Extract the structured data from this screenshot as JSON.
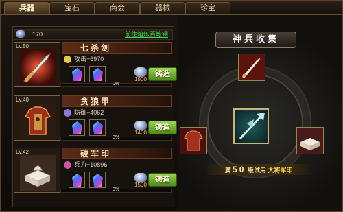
{
  "tabs": [
    {
      "label": "兵器",
      "active": true
    },
    {
      "label": "宝石",
      "active": false
    },
    {
      "label": "商会",
      "active": false
    },
    {
      "label": "器械",
      "active": false
    },
    {
      "label": "珍宝",
      "active": false
    }
  ],
  "resource": {
    "count": "170",
    "link": "前往熔炼百炼钢",
    "icon": "refined-steel-icon"
  },
  "items": [
    {
      "level": "Lv.50",
      "name": "七杀剑",
      "stat": "攻击+6970",
      "cost": "1900",
      "forge_label": "铸造",
      "progress_pct": 0,
      "progress_label": "0%",
      "stat_color": "#e8c74a"
    },
    {
      "level": "Lv.40",
      "name": "贪狼甲",
      "stat": "防御+4062",
      "cost": "1400",
      "forge_label": "铸造",
      "progress_pct": 0,
      "progress_label": "0%",
      "stat_color": "#8e7bd6"
    },
    {
      "level": "Lv.42",
      "name": "破军印",
      "stat": "兵力+10896",
      "cost": "1500",
      "forge_label": "铸造",
      "progress_pct": 0,
      "progress_label": "0%",
      "stat_color": "#c85c9a"
    }
  ],
  "collection": {
    "title": "神兵收集",
    "footer_prefix": "满",
    "footer_num": "50",
    "footer_mid": "级试用",
    "footer_reward": "大将军印"
  },
  "colors": {
    "accent_green": "#3ee24e",
    "forge_button": "#7ab83a",
    "cost_text": "#ffb36a"
  }
}
